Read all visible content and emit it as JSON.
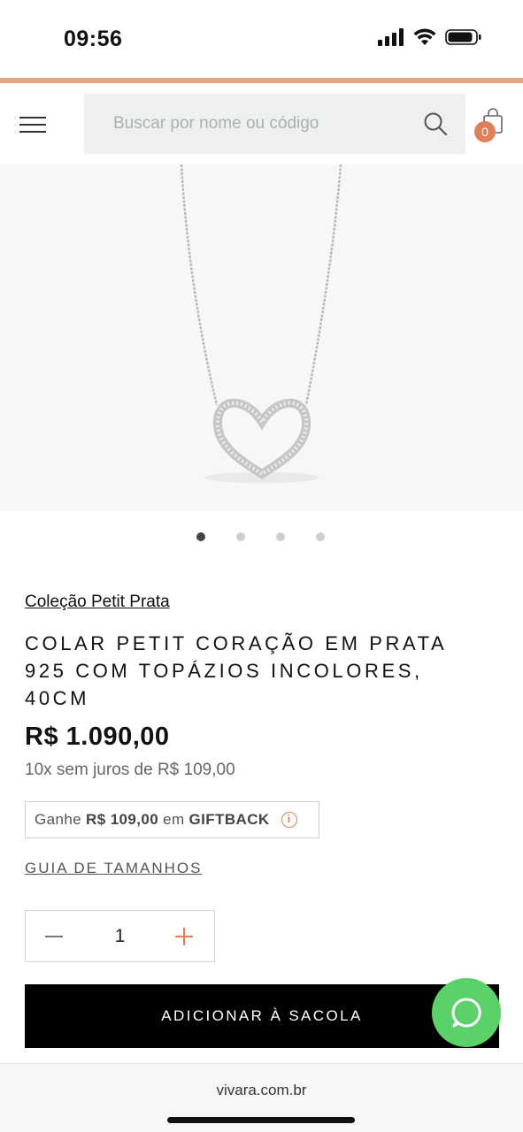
{
  "status": {
    "time": "09:56",
    "icons": [
      "signal-icon",
      "wifi-icon",
      "battery-icon"
    ]
  },
  "header": {
    "search_placeholder": "Buscar por nome ou código",
    "cart_count": "0"
  },
  "carousel": {
    "total": 4,
    "active": 1
  },
  "product": {
    "collection": "Coleção Petit Prata",
    "title": "COLAR PETIT CORAÇÃO EM PRATA 925 COM TOPÁZIOS INCOLORES, 40CM",
    "price": "R$ 1.090,00",
    "installments": "10x sem juros de R$ 109,00",
    "giftback_prefix": "Ganhe",
    "giftback_amount": "R$ 109,00",
    "giftback_mid": "em",
    "giftback_label": "GIFTBACK",
    "size_guide": "GUIA DE TAMANHOS",
    "quantity": "1",
    "add_to_bag": "ADICIONAR À SACOLA"
  },
  "browser": {
    "url": "vivara.com.br"
  },
  "colors": {
    "accent": "#e8a67f",
    "badge": "#e07f5a",
    "whatsapp": "#5dd169"
  }
}
